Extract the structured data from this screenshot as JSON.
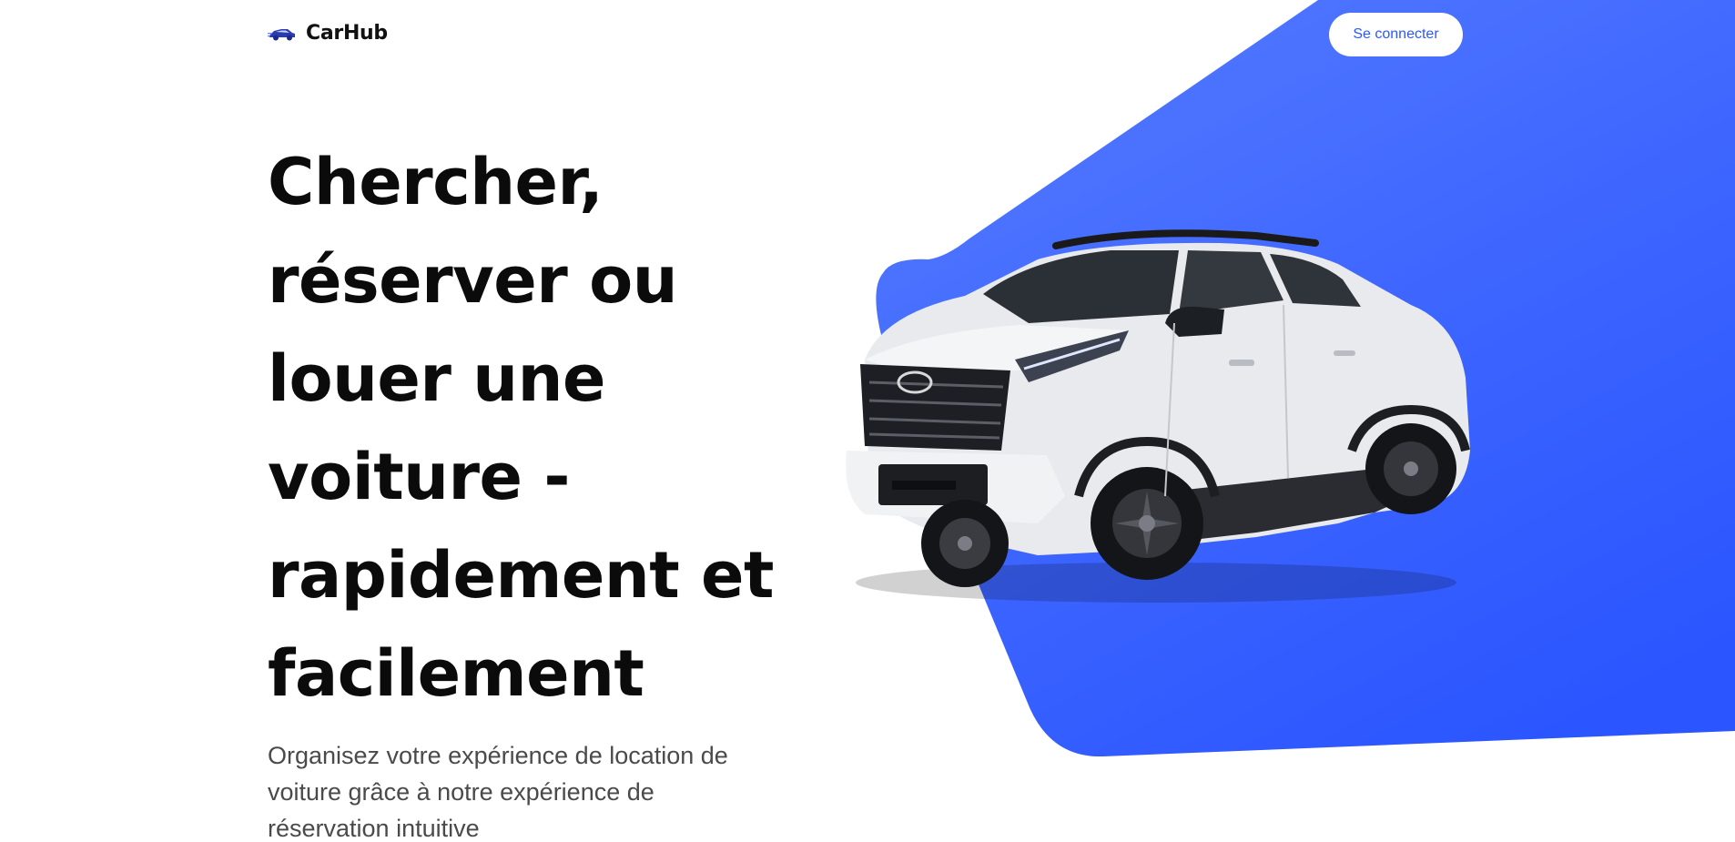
{
  "header": {
    "logo_text": "CarHub",
    "logo_icon": "car-icon",
    "login_label": "Se connecter"
  },
  "hero": {
    "title": "Chercher, réserver ou louer une voiture - rapidement et facilement",
    "subtitle": "Organisez votre expérience de location de voiture grâce à notre expérience de réservation intuitive",
    "image": "white-suv-image"
  },
  "colors": {
    "accent": "#2b59ff",
    "accent_light": "#4f75ff",
    "background": "#ffffff",
    "text": "#0b0b0b",
    "subtext": "#4a4a4a"
  }
}
